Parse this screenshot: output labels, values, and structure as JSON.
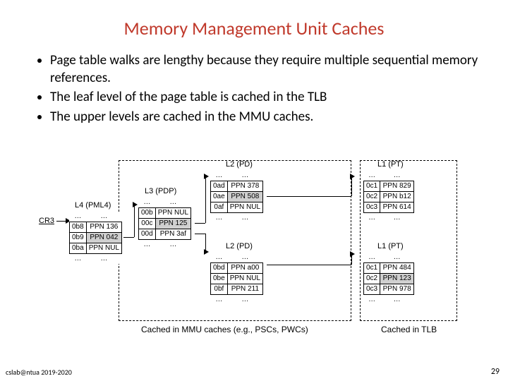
{
  "title": "Memory Management Unit Caches",
  "bullets": [
    "Page table walks are lengthy because they require multiple sequential memory references.",
    "The leaf level of the page table is cached in the TLB",
    "The upper levels are cached in the MMU caches."
  ],
  "footer": {
    "left": "cslab@ntua 2019-2020",
    "right": "29"
  },
  "diagram": {
    "captions": {
      "mmu": "Cached in MMU caches (e.g., PSCs, PWCs)",
      "tlb": "Cached in TLB"
    },
    "cr3": "CR3",
    "tables": {
      "l4": {
        "label": "L4 (PML4)",
        "rows": [
          {
            "idx": "…",
            "val": "…",
            "dots": true
          },
          {
            "idx": "0b8",
            "val": "PPN 136"
          },
          {
            "idx": "0b9",
            "val": "PPN 042",
            "hl": true
          },
          {
            "idx": "0ba",
            "val": "PPN NUL"
          },
          {
            "idx": "…",
            "val": "…",
            "dots": true
          }
        ]
      },
      "l3": {
        "label": "L3 (PDP)",
        "rows": [
          {
            "idx": "…",
            "val": "…",
            "dots": true
          },
          {
            "idx": "00b",
            "val": "PPN NUL"
          },
          {
            "idx": "00c",
            "val": "PPN 125",
            "hl": true
          },
          {
            "idx": "00d",
            "val": "PPN 3af"
          },
          {
            "idx": "…",
            "val": "…",
            "dots": true
          }
        ]
      },
      "l2a": {
        "label": "L2 (PD)",
        "rows": [
          {
            "idx": "…",
            "val": "…",
            "dots": true
          },
          {
            "idx": "0ad",
            "val": "PPN 378"
          },
          {
            "idx": "0ae",
            "val": "PPN 508",
            "hl": true
          },
          {
            "idx": "0af",
            "val": "PPN NUL"
          },
          {
            "idx": "…",
            "val": "…",
            "dots": true
          }
        ]
      },
      "l2b": {
        "label": "L2 (PD)",
        "rows": [
          {
            "idx": "…",
            "val": "…",
            "dots": true
          },
          {
            "idx": "0bd",
            "val": "PPN a00"
          },
          {
            "idx": "0be",
            "val": "PPN NUL"
          },
          {
            "idx": "0bf",
            "val": "PPN 211"
          },
          {
            "idx": "…",
            "val": "…",
            "dots": true
          }
        ]
      },
      "l1a": {
        "label": "L1 (PT)",
        "rows": [
          {
            "idx": "…",
            "val": "…",
            "dots": true
          },
          {
            "idx": "0c1",
            "val": "PPN 829"
          },
          {
            "idx": "0c2",
            "val": "PPN b12"
          },
          {
            "idx": "0c3",
            "val": "PPN 614"
          },
          {
            "idx": "…",
            "val": "…",
            "dots": true
          }
        ]
      },
      "l1b": {
        "label": "L1 (PT)",
        "rows": [
          {
            "idx": "…",
            "val": "…",
            "dots": true
          },
          {
            "idx": "0c1",
            "val": "PPN 484"
          },
          {
            "idx": "0c2",
            "val": "PPN 123",
            "hl": true
          },
          {
            "idx": "0c3",
            "val": "PPN 978"
          },
          {
            "idx": "…",
            "val": "…",
            "dots": true
          }
        ]
      }
    }
  }
}
